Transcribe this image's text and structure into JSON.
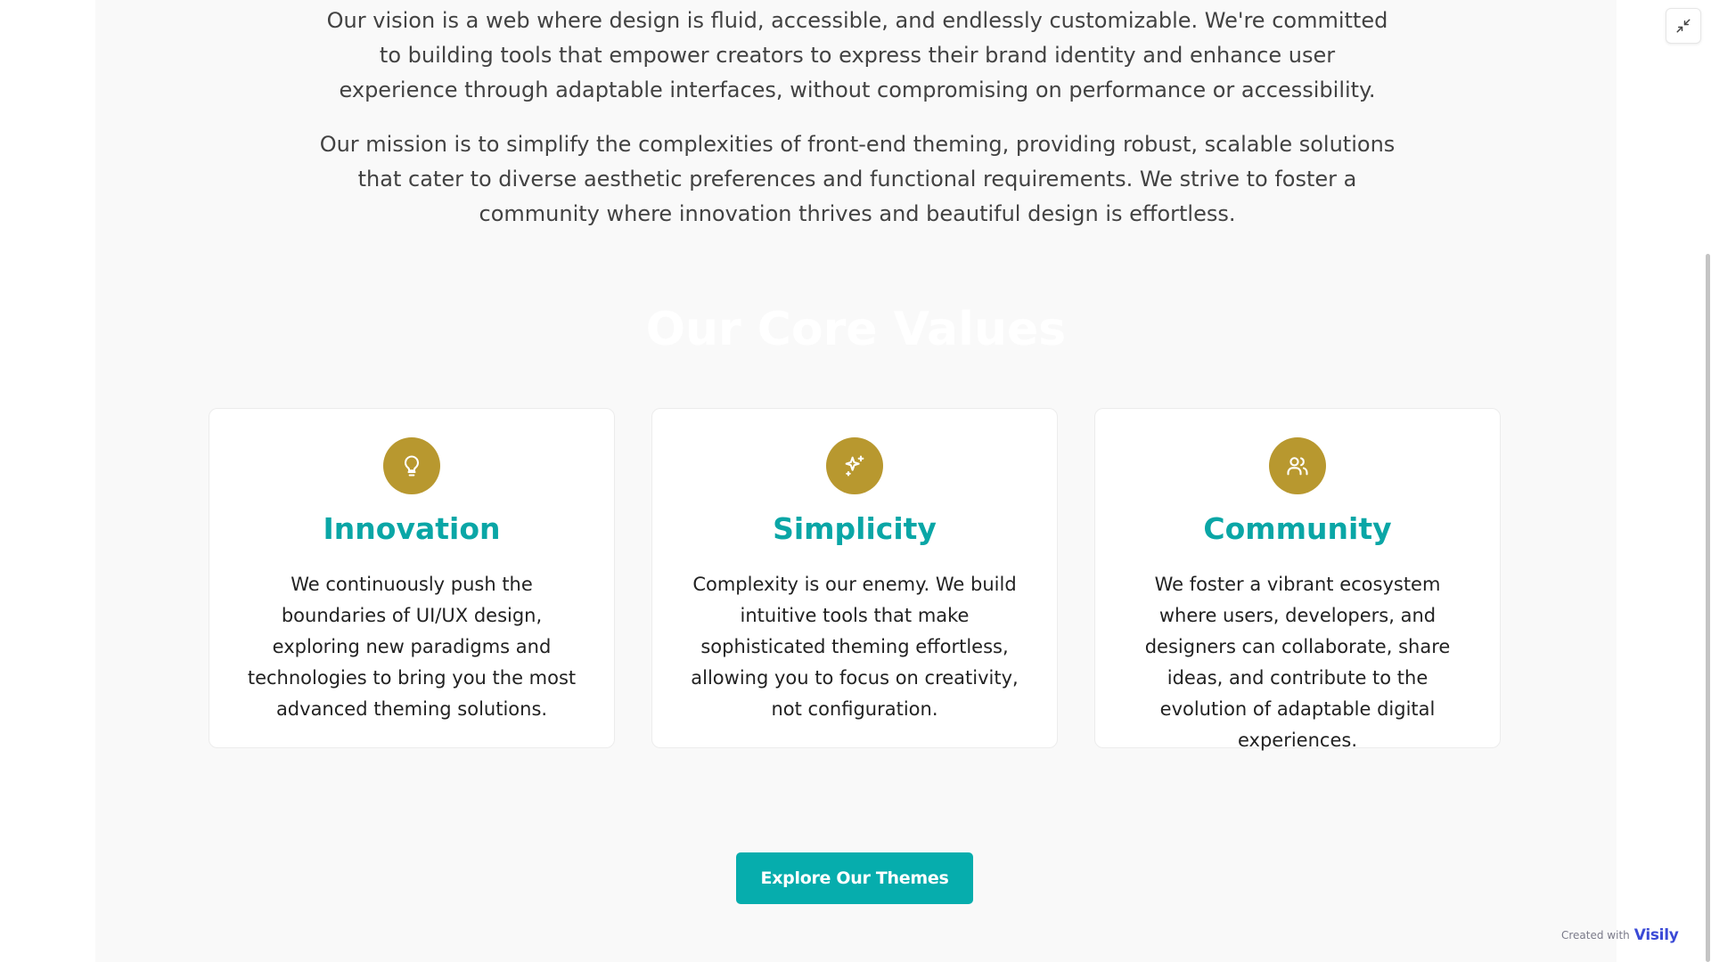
{
  "intro": {
    "vision": "Our vision is a web where design is fluid, accessible, and endlessly customizable. We're committed to building tools that empower creators to express their brand identity and enhance user experience through adaptable interfaces, without compromising on performance or accessibility.",
    "mission": "Our mission is to simplify the complexities of front-end theming, providing robust, scalable solutions that cater to diverse aesthetic preferences and functional requirements. We strive to foster a community where innovation thrives and beautiful design is effortless."
  },
  "values": {
    "heading": "Our Core Values",
    "cards": [
      {
        "icon": "lightbulb-icon",
        "title": "Innovation",
        "text": "We continuously push the boundaries of UI/UX design, exploring new paradigms and technologies to bring you the most advanced theming solutions."
      },
      {
        "icon": "sparkles-icon",
        "title": "Simplicity",
        "text": "Complexity is our enemy. We build intuitive tools that make sophisticated theming effortless, allowing you to focus on creativity, not configuration."
      },
      {
        "icon": "users-icon",
        "title": "Community",
        "text": "We foster a vibrant ecosystem where users, developers, and designers can collaborate, share ideas, and contribute to the evolution of adaptable digital experiences."
      }
    ]
  },
  "cta": {
    "label": "Explore Our Themes"
  },
  "badge": {
    "prefix": "Created with",
    "brand": "Visily"
  },
  "colors": {
    "accent": "#0aa6a6",
    "button": "#06adad",
    "icon_circle": "#b8982f",
    "page_bg": "#f9f9f9",
    "brand_logo": "#3b4ad6"
  }
}
